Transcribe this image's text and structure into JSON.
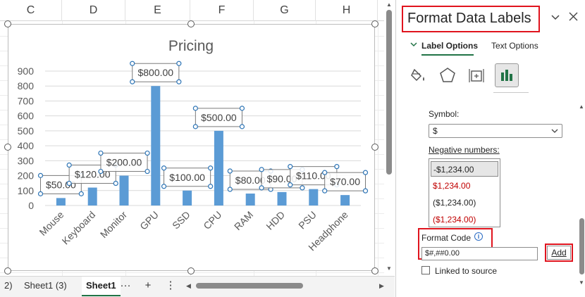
{
  "sheet": {
    "columns": [
      "C",
      "D",
      "E",
      "F",
      "G",
      "H"
    ]
  },
  "chart_data": {
    "type": "bar",
    "title": "Pricing",
    "categories": [
      "Mouse",
      "Keyboard",
      "Monitor",
      "GPU",
      "SSD",
      "CPU",
      "RAM",
      "HDD",
      "PSU",
      "Headphone"
    ],
    "values": [
      50,
      120,
      200,
      800,
      100,
      500,
      80,
      90,
      110,
      70
    ],
    "data_labels": [
      "$50.00",
      "$120.00",
      "$200.00",
      "$800.00",
      "$100.00",
      "$500.00",
      "$80.00",
      "$90.00",
      "$110.00",
      "$70.00"
    ],
    "y_ticks": [
      "0",
      "100",
      "200",
      "300",
      "400",
      "500",
      "600",
      "700",
      "800",
      "900"
    ],
    "ylim": [
      0,
      900
    ],
    "grid": true,
    "bar_color": "#5b9bd5"
  },
  "tabs": {
    "prev": "2)",
    "sheet1_3": "Sheet1 (3)",
    "active": "Sheet1",
    "more": "···",
    "add": "+",
    "options": "⋮"
  },
  "pane": {
    "title": "Format Data Labels",
    "dropdown_icon": "chevron-down-icon",
    "close_icon": "close-icon",
    "tab_label_options": "Label Options",
    "tab_text_options": "Text Options",
    "icons": [
      "fill-line-icon",
      "effects-icon",
      "size-properties-icon",
      "label-options-icon"
    ],
    "symbol_label": "Symbol:",
    "symbol_value": "$",
    "negative_label": "Negative numbers:",
    "negative_options": [
      {
        "text": "-$1,234.00",
        "color": "#262626"
      },
      {
        "text": "$1,234.00",
        "color": "#c00000"
      },
      {
        "text": "($1,234.00)",
        "color": "#262626"
      },
      {
        "text": "($1,234.00)",
        "color": "#c00000"
      }
    ],
    "format_code_label": "Format Code",
    "format_code_value": "$#,##0.00",
    "add_label": "Add",
    "linked_label": "Linked to source",
    "highlight_color": "#e0141e",
    "accent_color": "#217346"
  }
}
